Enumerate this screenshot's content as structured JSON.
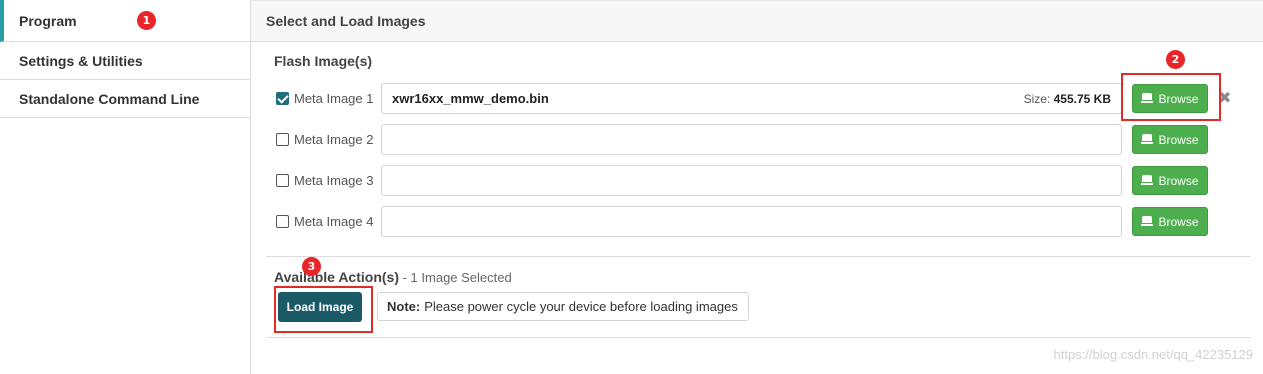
{
  "sidebar": {
    "items": [
      {
        "label": "Program",
        "badge": "1",
        "active": true
      },
      {
        "label": "Settings & Utilities",
        "active": false
      },
      {
        "label": "Standalone Command Line",
        "active": false
      }
    ]
  },
  "header": {
    "title": "Select and Load Images"
  },
  "flash": {
    "title": "Flash Image(s)",
    "browse_label": "Browse",
    "browse_badge": "2",
    "images": [
      {
        "label": "Meta Image 1",
        "checked": true,
        "file": "xwr16xx_mmw_demo.bin",
        "size_label": "Size:",
        "size_value": "455.75 KB"
      },
      {
        "label": "Meta Image 2",
        "checked": false,
        "file": ""
      },
      {
        "label": "Meta Image 3",
        "checked": false,
        "file": ""
      },
      {
        "label": "Meta Image 4",
        "checked": false,
        "file": ""
      }
    ],
    "remove_symbol": "✖"
  },
  "actions": {
    "title": "Available Action(s)",
    "subtitle": " - 1 Image Selected",
    "badge": "3",
    "load_label": "Load Image",
    "note_bold": "Note:",
    "note_text": "Please power cycle your device before loading images"
  },
  "watermark": "https://blog.csdn.net/qq_42235129",
  "colors": {
    "accent": "#2a9ca8",
    "browse": "#4cae4c",
    "load": "#1a5a67",
    "marker": "#e02b2b"
  }
}
